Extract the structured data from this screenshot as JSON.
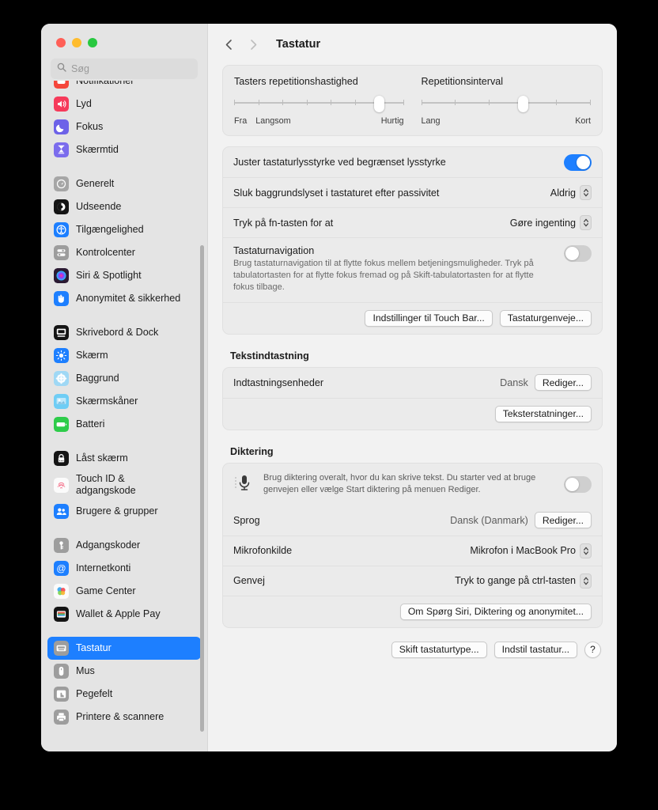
{
  "window": {
    "traffic_lights": [
      "close",
      "minimize",
      "zoom"
    ],
    "accent_color": "#1d7fff"
  },
  "search": {
    "placeholder": "Søg",
    "value": "",
    "icon": "search-icon"
  },
  "sidebar": {
    "items": [
      {
        "label": "Notifikationer",
        "icon": "notifications-icon",
        "group": 0,
        "partial": true
      },
      {
        "label": "Lyd",
        "icon": "sound-icon",
        "group": 0
      },
      {
        "label": "Fokus",
        "icon": "focus-icon",
        "group": 0
      },
      {
        "label": "Skærmtid",
        "icon": "screentime-icon",
        "group": 0
      },
      {
        "label": "Generelt",
        "icon": "general-icon",
        "group": 1
      },
      {
        "label": "Udseende",
        "icon": "appearance-icon",
        "group": 1
      },
      {
        "label": "Tilgængelighed",
        "icon": "accessibility-icon",
        "group": 1
      },
      {
        "label": "Kontrolcenter",
        "icon": "control-center-icon",
        "group": 1
      },
      {
        "label": "Siri & Spotlight",
        "icon": "siri-icon",
        "group": 1
      },
      {
        "label": "Anonymitet & sikkerhed",
        "icon": "privacy-icon",
        "group": 1
      },
      {
        "label": "Skrivebord & Dock",
        "icon": "desktop-dock-icon",
        "group": 2
      },
      {
        "label": "Skærm",
        "icon": "display-icon",
        "group": 2
      },
      {
        "label": "Baggrund",
        "icon": "wallpaper-icon",
        "group": 2
      },
      {
        "label": "Skærmskåner",
        "icon": "screensaver-icon",
        "group": 2
      },
      {
        "label": "Batteri",
        "icon": "battery-icon",
        "group": 2
      },
      {
        "label": "Låst skærm",
        "icon": "lock-screen-icon",
        "group": 3
      },
      {
        "label": "Touch ID &\nadgangskode",
        "icon": "touch-id-icon",
        "group": 3,
        "two_line": true
      },
      {
        "label": "Brugere & grupper",
        "icon": "users-groups-icon",
        "group": 3
      },
      {
        "label": "Adgangskoder",
        "icon": "passwords-icon",
        "group": 4
      },
      {
        "label": "Internetkonti",
        "icon": "internet-accounts-icon",
        "group": 4
      },
      {
        "label": "Game Center",
        "icon": "game-center-icon",
        "group": 4
      },
      {
        "label": "Wallet & Apple Pay",
        "icon": "wallet-icon",
        "group": 4
      },
      {
        "label": "Tastatur",
        "icon": "keyboard-icon",
        "group": 5,
        "selected": true
      },
      {
        "label": "Mus",
        "icon": "mouse-icon",
        "group": 5
      },
      {
        "label": "Pegefelt",
        "icon": "trackpad-icon",
        "group": 5
      },
      {
        "label": "Printere & scannere",
        "icon": "printers-scanners-icon",
        "group": 5
      }
    ]
  },
  "header": {
    "back_icon": "chevron-left-icon",
    "forward_icon": "chevron-right-icon",
    "title": "Tastatur"
  },
  "sliders": [
    {
      "label": "Tasters repetitionshastighed",
      "ticks": 8,
      "value_index": 6,
      "left_labels": [
        "Fra",
        "Langsom"
      ],
      "right_label": "Hurtig"
    },
    {
      "label": "Repetitionsinterval",
      "ticks": 6,
      "value_index": 3,
      "left_labels": [
        "Lang"
      ],
      "right_label": "Kort"
    }
  ],
  "keyboard_card": {
    "rows": [
      {
        "label": "Juster tastaturlysstyrke ved begrænset lysstyrke",
        "control": "toggle",
        "value": "on"
      },
      {
        "label": "Sluk baggrundslyset i tastaturet efter passivitet",
        "control": "popup",
        "value": "Aldrig"
      },
      {
        "label": "Tryk på fn-tasten for at",
        "control": "popup",
        "value": "Gøre ingenting"
      }
    ],
    "navigation": {
      "title": "Tastaturnavigation",
      "description": "Brug tastaturnavigation til at flytte fokus mellem betjeningsmuligheder. Tryk på tabulatortasten for at flytte fokus fremad og på Skift-tabulatortasten for at flytte fokus tilbage.",
      "toggle": "off"
    },
    "buttons": [
      "Indstillinger til Touch Bar...",
      "Tastaturgenveje..."
    ]
  },
  "text_input": {
    "title": "Tekstindtastning",
    "row": {
      "label": "Indtastningsenheder",
      "value": "Dansk",
      "button": "Rediger..."
    },
    "button": "Teksterstatninger..."
  },
  "dictation": {
    "title": "Diktering",
    "icon": "microphone-icon",
    "description": "Brug diktering overalt, hvor du kan skrive tekst. Du starter ved at bruge genvejen eller vælge Start diktering på menuen Rediger.",
    "toggle": "off",
    "rows": [
      {
        "label": "Sprog",
        "value": "Dansk (Danmark)",
        "control": "button",
        "button": "Rediger..."
      },
      {
        "label": "Mikrofonkilde",
        "value": "Mikrofon i MacBook Pro",
        "control": "popup"
      },
      {
        "label": "Genvej",
        "value": "Tryk to gange på ctrl-tasten",
        "control": "popup"
      }
    ],
    "button": "Om Spørg Siri, Diktering og anonymitet..."
  },
  "footer": {
    "buttons": [
      "Skift tastaturtype...",
      "Indstil tastatur..."
    ],
    "help": "?"
  }
}
